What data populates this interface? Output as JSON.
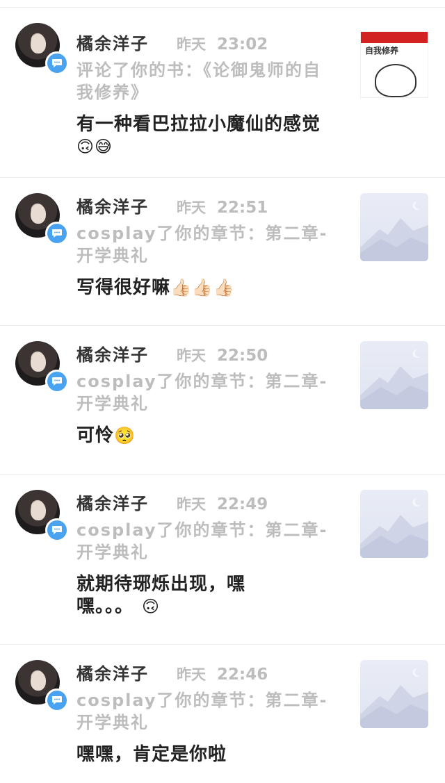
{
  "notifications": [
    {
      "user": "橘余洋子",
      "date": "昨天",
      "time": "23:02",
      "ref": "评论了你的书：《论御鬼师的自我修养》",
      "comment": "有一种看巴拉拉小魔仙的感觉",
      "emoji": "🙃😅",
      "thumb": "book-cover",
      "cover_title": "自我修养"
    },
    {
      "user": "橘余洋子",
      "date": "昨天",
      "time": "22:51",
      "ref": "cosplay了你的章节：第二章-开学典礼",
      "comment": "写得很好嘛",
      "emoji": "👍🏻👍🏻👍🏻",
      "thumb": "placeholder-image"
    },
    {
      "user": "橘余洋子",
      "date": "昨天",
      "time": "22:50",
      "ref": "cosplay了你的章节：第二章-开学典礼",
      "comment": "可怜",
      "emoji": "🥺",
      "thumb": "placeholder-image"
    },
    {
      "user": "橘余洋子",
      "date": "昨天",
      "time": "22:49",
      "ref": "cosplay了你的章节：第二章-开学典礼",
      "comment": "就期待琊烁出现，嘿嘿。。。",
      "emoji": "🙃",
      "thumb": "placeholder-image"
    },
    {
      "user": "橘余洋子",
      "date": "昨天",
      "time": "22:46",
      "ref": "cosplay了你的章节：第二章-开学典礼",
      "comment": "嘿嘿，肯定是你啦",
      "emoji": "",
      "thumb": "placeholder-image"
    }
  ],
  "colors": {
    "badge": "#4aa3f0",
    "meta_text": "#bdbdbd",
    "divider": "#ececec"
  }
}
